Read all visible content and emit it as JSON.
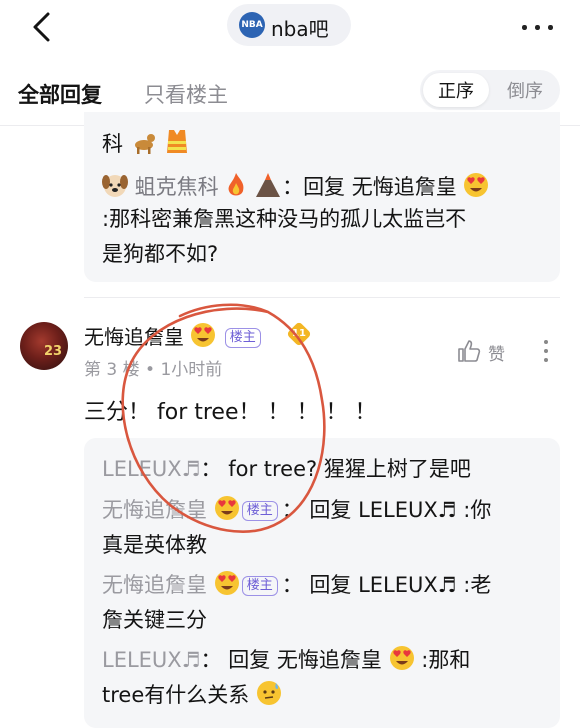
{
  "header": {
    "title": "nba吧",
    "logo_text": "NBA"
  },
  "tabs": {
    "all": "全部回复",
    "owner_only": "只看楼主"
  },
  "sort": {
    "asc": "正序",
    "desc": "倒序"
  },
  "prev_replies": {
    "fragment": "科",
    "reply": {
      "author": "蛆克焦科",
      "action": "回复",
      "target": "无悔追詹皇",
      "text_line1": ":那科密兼詹黑这种没马的孤儿太监岂不",
      "text_line2": "是狗都不如?"
    }
  },
  "post": {
    "username": "无悔追詹皇",
    "owner_badge": "楼主",
    "level": "11",
    "meta": "第 3 楼 • 1小时前",
    "like_label": "赞",
    "content": "三分！ for tree！ ！ ！ ！ ！",
    "avatar_text": "23"
  },
  "replies": [
    {
      "author": "LELEUX",
      "text": "for tree? 猩猩上树了是吧"
    },
    {
      "author": "无悔追詹皇",
      "badge": "楼主",
      "action": "回复",
      "target": "LELEUX",
      "text_line1": ":你",
      "text_line2": "真是英体教"
    },
    {
      "author": "无悔追詹皇",
      "badge": "楼主",
      "action": "回复",
      "target": "LELEUX",
      "text_line1": ":老",
      "text_line2": "詹关键三分"
    },
    {
      "author": "LELEUX",
      "action": "回复",
      "target": "无悔追詹皇",
      "text_line1": ":那和",
      "text_line2": "tree有什么关系"
    }
  ],
  "colors": {
    "owner_badge": "#6e5fd6",
    "annotation": "#d9573f",
    "reply_bg": "#f5f6f8"
  }
}
